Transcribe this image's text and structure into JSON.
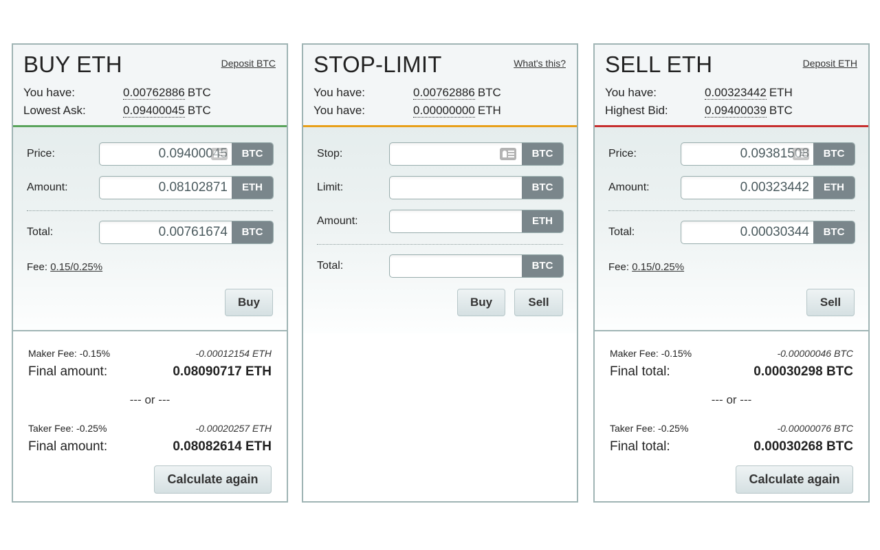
{
  "panels": {
    "buy": {
      "title": "BUY ETH",
      "link": "Deposit BTC",
      "balances": [
        {
          "label": "You have:",
          "value": "0.00762886",
          "currency": "BTC"
        },
        {
          "label": "Lowest Ask:",
          "value": "0.09400045",
          "currency": "BTC"
        }
      ],
      "accent_color": "#5aa45c",
      "fields": {
        "price": {
          "label": "Price:",
          "value": "0.09400045",
          "currency": "BTC"
        },
        "amount": {
          "label": "Amount:",
          "value": "0.08102871",
          "currency": "ETH"
        },
        "total": {
          "label": "Total:",
          "value": "0.00761674",
          "currency": "BTC"
        }
      },
      "fee_label": "Fee:",
      "fee_value": "0.15/0.25%",
      "action_button": "Buy",
      "calc": {
        "maker_fee_label": "Maker Fee: -0.15%",
        "maker_fee_amount": "-0.00012154 ETH",
        "maker_final_label": "Final amount:",
        "maker_final_value": "0.08090717 ETH",
        "or_label": "--- or ---",
        "taker_fee_label": "Taker Fee: -0.25%",
        "taker_fee_amount": "-0.00020257 ETH",
        "taker_final_label": "Final amount:",
        "taker_final_value": "0.08082614 ETH",
        "button": "Calculate again"
      }
    },
    "stop": {
      "title": "STOP-LIMIT",
      "link": "What's this?",
      "balances": [
        {
          "label": "You have:",
          "value": "0.00762886",
          "currency": "BTC"
        },
        {
          "label": "You have:",
          "value": "0.00000000",
          "currency": "ETH"
        }
      ],
      "accent_color": "#e8a01a",
      "fields": {
        "stop": {
          "label": "Stop:",
          "value": "",
          "currency": "BTC"
        },
        "limit": {
          "label": "Limit:",
          "value": "",
          "currency": "BTC"
        },
        "amount": {
          "label": "Amount:",
          "value": "",
          "currency": "ETH"
        },
        "total": {
          "label": "Total:",
          "value": "",
          "currency": "BTC"
        }
      },
      "buy_button": "Buy",
      "sell_button": "Sell"
    },
    "sell": {
      "title": "SELL ETH",
      "link": "Deposit ETH",
      "balances": [
        {
          "label": "You have:",
          "value": "0.00323442",
          "currency": "ETH"
        },
        {
          "label": "Highest Bid:",
          "value": "0.09400039",
          "currency": "BTC"
        }
      ],
      "accent_color": "#c72f2f",
      "fields": {
        "price": {
          "label": "Price:",
          "value": "0.09381508",
          "currency": "BTC"
        },
        "amount": {
          "label": "Amount:",
          "value": "0.00323442",
          "currency": "ETH"
        },
        "total": {
          "label": "Total:",
          "value": "0.00030344",
          "currency": "BTC"
        }
      },
      "fee_label": "Fee:",
      "fee_value": "0.15/0.25%",
      "action_button": "Sell",
      "calc": {
        "maker_fee_label": "Maker Fee: -0.15%",
        "maker_fee_amount": "-0.00000046 BTC",
        "maker_final_label": "Final total:",
        "maker_final_value": "0.00030298 BTC",
        "or_label": "--- or ---",
        "taker_fee_label": "Taker Fee: -0.25%",
        "taker_fee_amount": "-0.00000076 BTC",
        "taker_final_label": "Final total:",
        "taker_final_value": "0.00030268 BTC",
        "button": "Calculate again"
      }
    }
  }
}
